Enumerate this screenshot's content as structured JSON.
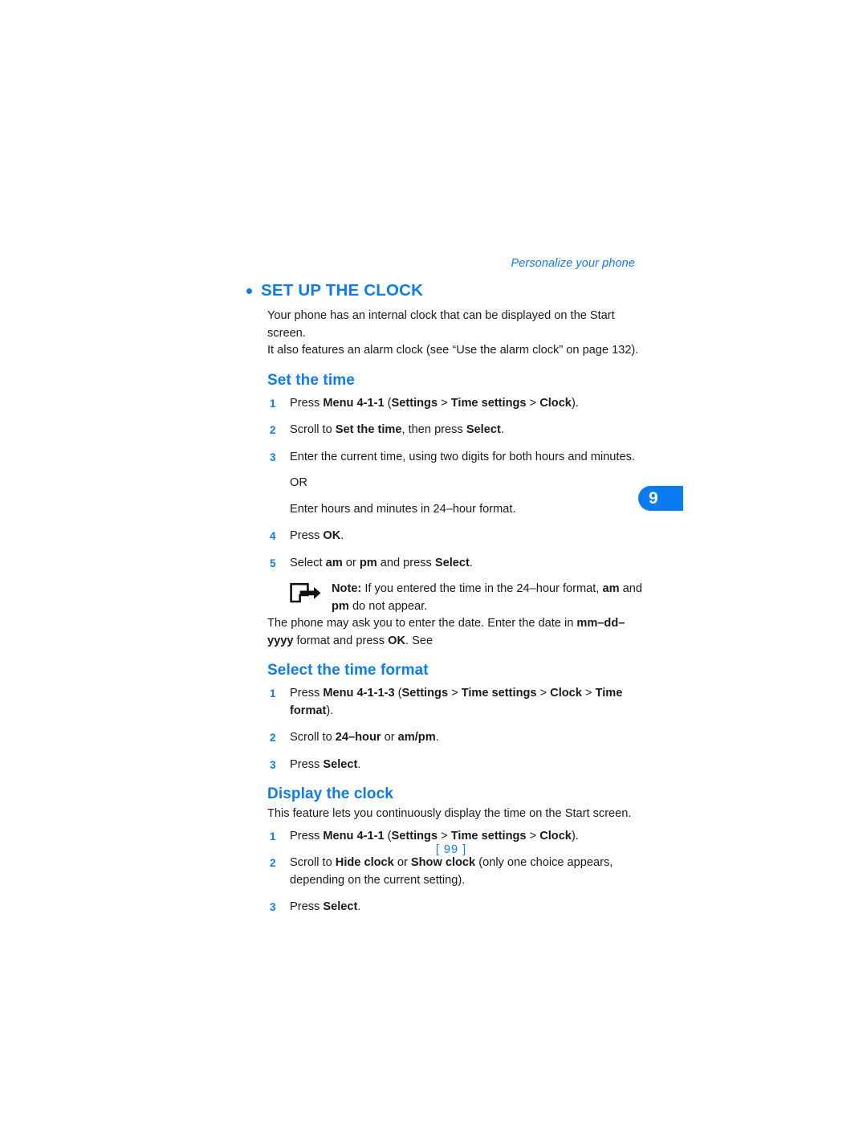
{
  "header": {
    "running_head": "Personalize your phone"
  },
  "chapter_tab": {
    "number": "9",
    "color": "#0a7cf0"
  },
  "section": {
    "title": "SET UP THE CLOCK",
    "intro_line1": "Your phone has an internal clock that can be displayed on the Start screen.",
    "intro_line2": "It also features an alarm clock (see “Use the alarm clock” on page 132)."
  },
  "set_the_time": {
    "title": "Set the time",
    "steps": [
      {
        "num": "1",
        "parts": [
          {
            "t": "Press ",
            "b": false
          },
          {
            "t": "Menu 4-1-1",
            "b": true
          },
          {
            "t": " (",
            "b": false
          },
          {
            "t": "Settings",
            "b": true
          },
          {
            "t": " > ",
            "b": false
          },
          {
            "t": "Time settings",
            "b": true
          },
          {
            "t": " > ",
            "b": false
          },
          {
            "t": "Clock",
            "b": true
          },
          {
            "t": ").",
            "b": false
          }
        ]
      },
      {
        "num": "2",
        "parts": [
          {
            "t": "Scroll to ",
            "b": false
          },
          {
            "t": "Set the time",
            "b": true
          },
          {
            "t": ", then press ",
            "b": false
          },
          {
            "t": "Select",
            "b": true
          },
          {
            "t": ".",
            "b": false
          }
        ]
      },
      {
        "num": "3",
        "parts": [
          {
            "t": "Enter the current time, using two digits for both hours and minutes.",
            "b": false
          }
        ],
        "extra": [
          "OR",
          "Enter hours and minutes in 24–hour format."
        ]
      },
      {
        "num": "4",
        "parts": [
          {
            "t": "Press ",
            "b": false
          },
          {
            "t": "OK",
            "b": true
          },
          {
            "t": ".",
            "b": false
          }
        ]
      },
      {
        "num": "5",
        "parts": [
          {
            "t": "Select ",
            "b": false
          },
          {
            "t": "am",
            "b": true
          },
          {
            "t": " or ",
            "b": false
          },
          {
            "t": "pm",
            "b": true
          },
          {
            "t": " and press ",
            "b": false
          },
          {
            "t": "Select",
            "b": true
          },
          {
            "t": ".",
            "b": false
          }
        ]
      }
    ],
    "note": {
      "icon": "note-arrow-icon",
      "parts": [
        {
          "t": "Note:",
          "b": true
        },
        {
          "t": " If you entered the time in the 24–hour format, ",
          "b": false
        },
        {
          "t": "am",
          "b": true
        },
        {
          "t": " and ",
          "b": false
        },
        {
          "t": "pm",
          "b": true
        },
        {
          "t": " do not appear.",
          "b": false
        }
      ]
    },
    "trailing": [
      {
        "t": "The phone may ask you to enter the date. Enter the date in ",
        "b": false
      },
      {
        "t": "mm–dd–yyyy",
        "b": true
      },
      {
        "t": " format and press ",
        "b": false
      },
      {
        "t": "OK",
        "b": true
      },
      {
        "t": ". See",
        "b": false
      }
    ]
  },
  "select_the_time_format": {
    "title": "Select the time format",
    "steps": [
      {
        "num": "1",
        "parts": [
          {
            "t": "Press ",
            "b": false
          },
          {
            "t": "Menu 4-1-1-3",
            "b": true
          },
          {
            "t": " (",
            "b": false
          },
          {
            "t": "Settings",
            "b": true
          },
          {
            "t": " > ",
            "b": false
          },
          {
            "t": "Time settings",
            "b": true
          },
          {
            "t": " > ",
            "b": false
          },
          {
            "t": "Clock",
            "b": true
          },
          {
            "t": " > ",
            "b": false
          },
          {
            "t": "Time format",
            "b": true
          },
          {
            "t": ").",
            "b": false
          }
        ]
      },
      {
        "num": "2",
        "parts": [
          {
            "t": "Scroll to ",
            "b": false
          },
          {
            "t": "24–hour",
            "b": true
          },
          {
            "t": " or ",
            "b": false
          },
          {
            "t": "am/pm",
            "b": true
          },
          {
            "t": ".",
            "b": false
          }
        ]
      },
      {
        "num": "3",
        "parts": [
          {
            "t": "Press ",
            "b": false
          },
          {
            "t": "Select",
            "b": true
          },
          {
            "t": ".",
            "b": false
          }
        ]
      }
    ]
  },
  "display_the_clock": {
    "title": "Display the clock",
    "intro": "This feature lets you continuously display the time on the Start screen.",
    "steps": [
      {
        "num": "1",
        "parts": [
          {
            "t": "Press ",
            "b": false
          },
          {
            "t": "Menu 4-1-1",
            "b": true
          },
          {
            "t": " (",
            "b": false
          },
          {
            "t": "Settings",
            "b": true
          },
          {
            "t": " > ",
            "b": false
          },
          {
            "t": "Time settings",
            "b": true
          },
          {
            "t": " > ",
            "b": false
          },
          {
            "t": "Clock",
            "b": true
          },
          {
            "t": ").",
            "b": false
          }
        ]
      },
      {
        "num": "2",
        "parts": [
          {
            "t": "Scroll to ",
            "b": false
          },
          {
            "t": "Hide clock",
            "b": true
          },
          {
            "t": " or ",
            "b": false
          },
          {
            "t": "Show clock",
            "b": true
          },
          {
            "t": " (only one choice appears, depending on the current setting).",
            "b": false
          }
        ]
      },
      {
        "num": "3",
        "parts": [
          {
            "t": "Press ",
            "b": false
          },
          {
            "t": "Select",
            "b": true
          },
          {
            "t": ".",
            "b": false
          }
        ]
      }
    ]
  },
  "footer": {
    "folio": "[ 99 ]"
  }
}
